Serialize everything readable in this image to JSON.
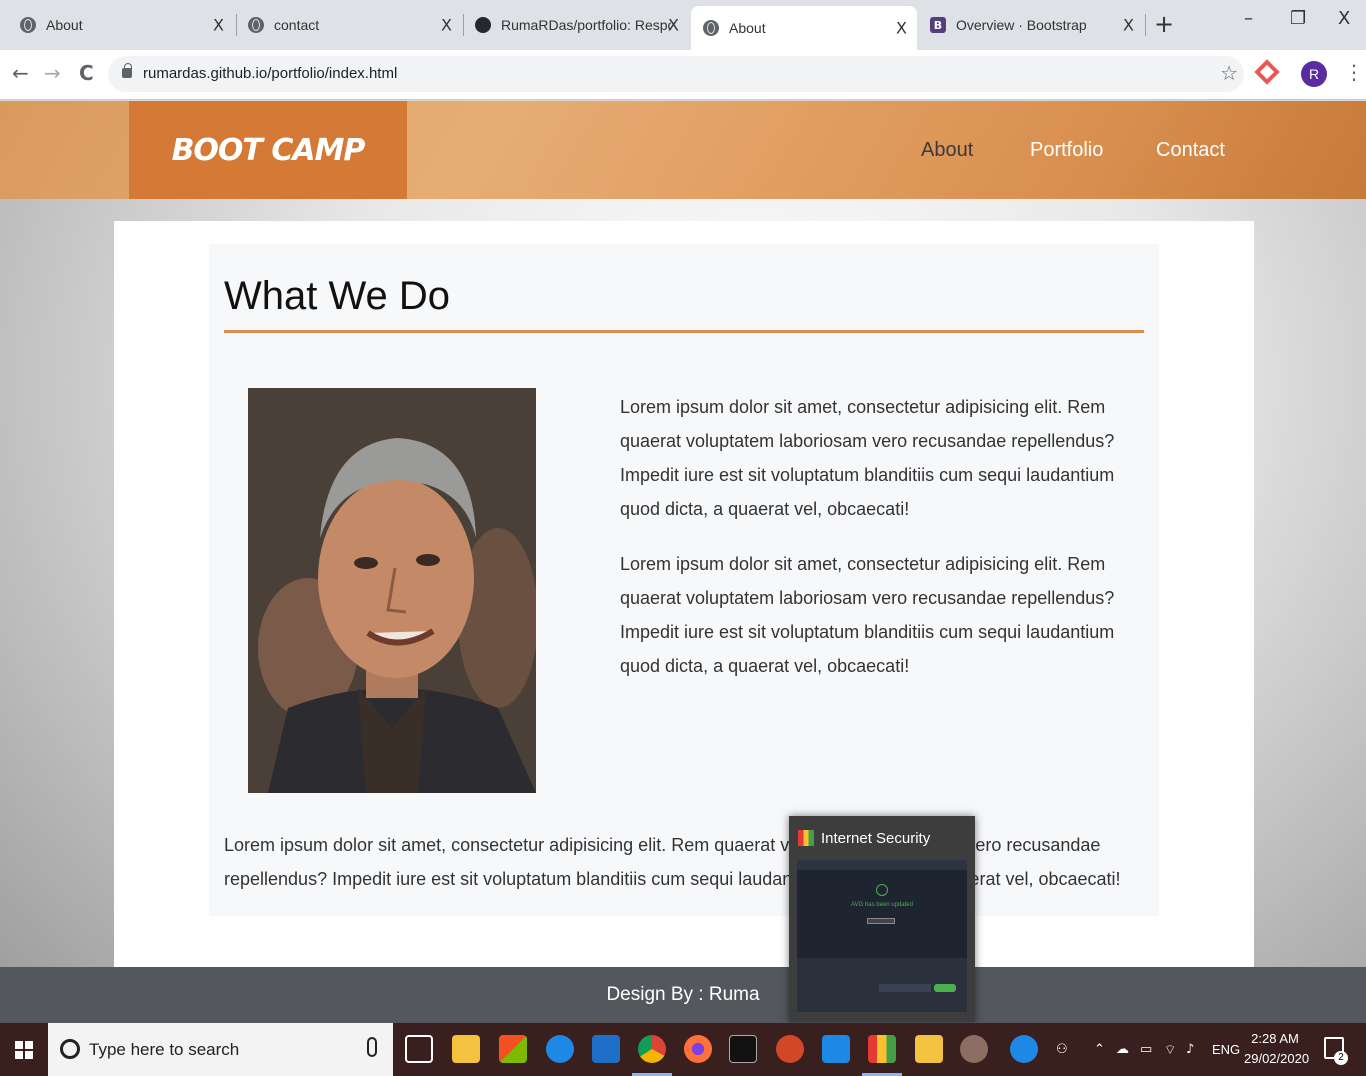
{
  "browser": {
    "tabs": [
      {
        "label": "About",
        "icon": "globe-icon"
      },
      {
        "label": "contact",
        "icon": "globe-icon"
      },
      {
        "label": "RumaRDas/portfolio: Responsi",
        "icon": "github-icon"
      },
      {
        "label": "About",
        "icon": "globe-icon"
      },
      {
        "label": "Overview · Bootstrap",
        "icon": "bootstrap-icon"
      }
    ],
    "bootstrap_icon_letter": "B",
    "tab_close": "X",
    "new_tab": "+",
    "window_controls": {
      "minimize": "–",
      "restore": "❐",
      "close": "X"
    },
    "nav": {
      "back": "←",
      "forward": "→",
      "reload": "C"
    },
    "url": "rumardas.github.io/portfolio/index.html",
    "bookmark": "☆",
    "profile_initial": "R",
    "menu": "⋮"
  },
  "site": {
    "brand": "BOOT CAMP",
    "nav": [
      "About",
      "Portfolio",
      "Contact"
    ],
    "title": "What We Do",
    "paragraphs": [
      "Lorem ipsum dolor sit amet, consectetur adipisicing elit. Rem quaerat voluptatem laboriosam vero recusandae repellendus? Impedit iure est sit voluptatum blanditiis cum sequi laudantium quod dicta, a quaerat vel, obcaecati!",
      "Lorem ipsum dolor sit amet, consectetur adipisicing elit. Rem quaerat voluptatem laboriosam vero recusandae repellendus? Impedit iure est sit voluptatum blanditiis cum sequi laudantium quod dicta, a quaerat vel, obcaecati!",
      "Lorem ipsum dolor sit amet, consectetur adipisicing elit. Rem quaerat voluptatem laboriosam vero recusandae repellendus? Impedit iure est sit voluptatum blanditiis cum sequi laudantium quod dicta, a quaerat vel, obcaecati!"
    ],
    "footer": "Design By : Ruma",
    "colors": {
      "brand_box": "#d47a36",
      "accent_rule": "#d88e4e",
      "footer": "#54585c"
    }
  },
  "popup": {
    "title": "Internet Security",
    "status": "AVG has been updated"
  },
  "taskbar": {
    "search_placeholder": "Type here to search",
    "language": "ENG",
    "time": "2:28 AM",
    "date": "29/02/2020",
    "notification_count": "2"
  }
}
